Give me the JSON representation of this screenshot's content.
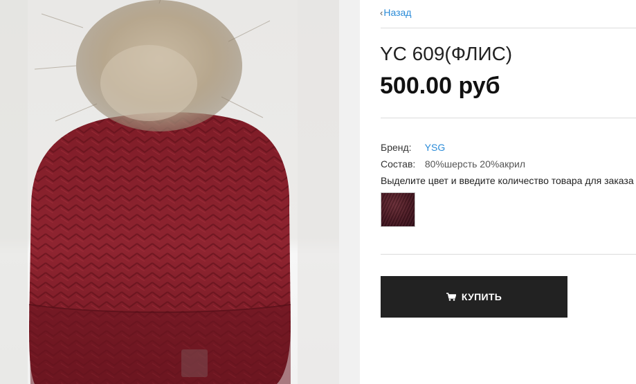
{
  "nav": {
    "back_label": "Назад"
  },
  "product": {
    "title": "YC 609(ФЛИС)",
    "price": "500.00 руб",
    "image_icon": "knit-hat-with-fur-pompom-photo"
  },
  "attributes": [
    {
      "label": "Бренд:",
      "value": "YSG",
      "link": true
    },
    {
      "label": "Состав:",
      "value": "80%шерсть 20%акрил",
      "link": false
    }
  ],
  "color_hint": "Выделите цвет и введите количество товара для заказа",
  "swatch": {
    "color": "#4a1822"
  },
  "buy_button": {
    "label": "КУПИТЬ",
    "icon": "cart-icon"
  },
  "colors": {
    "link": "#2a8bd8",
    "button_bg": "#222222",
    "hat": "#8a1f2a"
  }
}
